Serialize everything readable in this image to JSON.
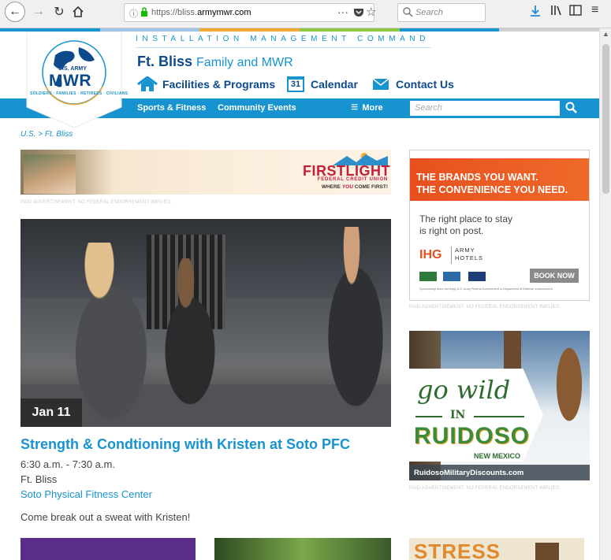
{
  "browser": {
    "url_prefix": "https://bliss.",
    "url_domain": "armymwr.com",
    "search_placeholder": "Search",
    "menu_dots": "···"
  },
  "header": {
    "logo_top": "U.S. ARMY",
    "logo_main": "MWR",
    "logo_ring": "SOLDIERS · FAMILIES · RETIREES · CIVILIANS",
    "command": "INSTALLATION MANAGEMENT COMMAND",
    "site_bold": "Ft. Bliss",
    "site_rest": "Family and MWR",
    "nav": [
      {
        "label": "Facilities & Programs",
        "icon": "home-icon"
      },
      {
        "label": "Calendar",
        "icon": "calendar-icon",
        "icon_text": "31"
      },
      {
        "label": "Contact Us",
        "icon": "mail-icon"
      }
    ],
    "bar_links": [
      "Sports & Fitness",
      "Community Events"
    ],
    "more_label": "More",
    "search_placeholder": "Search"
  },
  "breadcrumb": {
    "root": "U.S.",
    "sep": ">",
    "current": "Ft. Bliss"
  },
  "ads": {
    "firstlight_name": "FIRSTLIGHT",
    "firstlight_sub": "FEDERAL CREDIT UNION",
    "firstlight_tag1": "WHERE",
    "firstlight_tag2": "YOU",
    "firstlight_tag3": "COME FIRST!",
    "disclaimer": "PAID ADVERTISEMENT. NO FEDERAL ENDORSEMENT IMPLIED.",
    "ihg_line1": "THE BRANDS YOU WANT.",
    "ihg_line2": "THE CONVENIENCE YOU NEED.",
    "ihg_body1": "The right place to stay",
    "ihg_body2": "is right on post.",
    "ihg_logo": "IHG",
    "ihg_army1": "ARMY",
    "ihg_army2": "HOTELS",
    "ihg_button": "BOOK NOW",
    "ihg_fine": "Sponsorship does not imply U.S. Army Federal Government or Department of Defense endorsement.",
    "ruidoso_go": "go wild",
    "ruidoso_in": "IN",
    "ruidoso_name": "RUIDOSO",
    "ruidoso_state": "NEW MEXICO",
    "ruidoso_url": "RuidosoMilitaryDiscounts.com",
    "stress_partial": "STRESS"
  },
  "event": {
    "date_badge": "Jan 11",
    "title": "Strength & Condtioning with Kristen at Soto PFC",
    "time": "6:30 a.m. - 7:30 a.m.",
    "location": "Ft. Bliss",
    "venue": "Soto Physical Fitness Center",
    "description": "Come break out a sweat with Kristen!"
  },
  "colors": {
    "brand_blue": "#1793d0",
    "navy": "#0c4a8c",
    "ihg_orange": "#e8501e",
    "ruidoso_green": "#3c8a3c"
  }
}
